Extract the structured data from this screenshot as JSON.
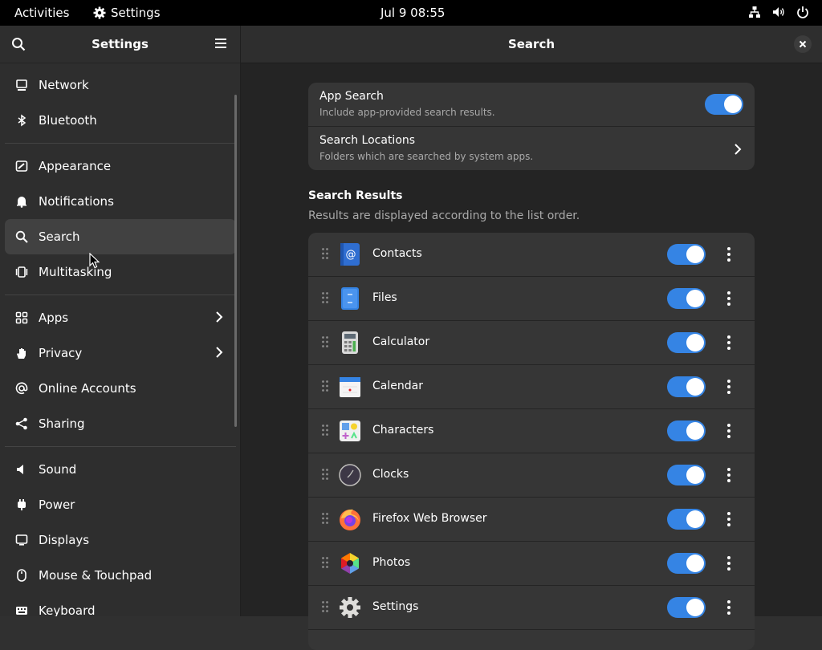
{
  "topbar": {
    "activities": "Activities",
    "app_name": "Settings",
    "clock": "Jul 9  08:55"
  },
  "sidebar": {
    "title": "Settings",
    "items": [
      {
        "label": "Network",
        "icon": "network-icon"
      },
      {
        "label": "Bluetooth",
        "icon": "bluetooth-icon"
      },
      {
        "label": "Appearance",
        "icon": "appearance-icon"
      },
      {
        "label": "Notifications",
        "icon": "bell-icon"
      },
      {
        "label": "Search",
        "icon": "search-icon",
        "active": true
      },
      {
        "label": "Multitasking",
        "icon": "multitasking-icon"
      },
      {
        "label": "Apps",
        "icon": "apps-icon",
        "chevron": true
      },
      {
        "label": "Privacy",
        "icon": "hand-icon",
        "chevron": true
      },
      {
        "label": "Online Accounts",
        "icon": "at-icon"
      },
      {
        "label": "Sharing",
        "icon": "share-icon"
      },
      {
        "label": "Sound",
        "icon": "speaker-icon"
      },
      {
        "label": "Power",
        "icon": "power-plug-icon"
      },
      {
        "label": "Displays",
        "icon": "display-icon"
      },
      {
        "label": "Mouse & Touchpad",
        "icon": "mouse-icon"
      },
      {
        "label": "Keyboard",
        "icon": "keyboard-icon"
      }
    ]
  },
  "main": {
    "title": "Search",
    "app_search": {
      "title": "App Search",
      "subtitle": "Include app-provided search results.",
      "enabled": true
    },
    "search_locations": {
      "title": "Search Locations",
      "subtitle": "Folders which are searched by system apps."
    },
    "results_section": {
      "title": "Search Results",
      "subtitle": "Results are displayed according to the list order."
    },
    "results": [
      {
        "name": "Contacts",
        "icon": "contacts-icon",
        "enabled": true
      },
      {
        "name": "Files",
        "icon": "files-icon",
        "enabled": true
      },
      {
        "name": "Calculator",
        "icon": "calculator-icon",
        "enabled": true
      },
      {
        "name": "Calendar",
        "icon": "calendar-icon",
        "enabled": true
      },
      {
        "name": "Characters",
        "icon": "characters-icon",
        "enabled": true
      },
      {
        "name": "Clocks",
        "icon": "clocks-icon",
        "enabled": true
      },
      {
        "name": "Firefox Web Browser",
        "icon": "firefox-icon",
        "enabled": true
      },
      {
        "name": "Photos",
        "icon": "photos-icon",
        "enabled": true
      },
      {
        "name": "Settings",
        "icon": "settings-gear-icon",
        "enabled": true
      }
    ]
  },
  "colors": {
    "accent": "#3584e4",
    "sidebar_bg": "#2e2e2e",
    "content_bg": "#242424",
    "card_bg": "#363636"
  }
}
